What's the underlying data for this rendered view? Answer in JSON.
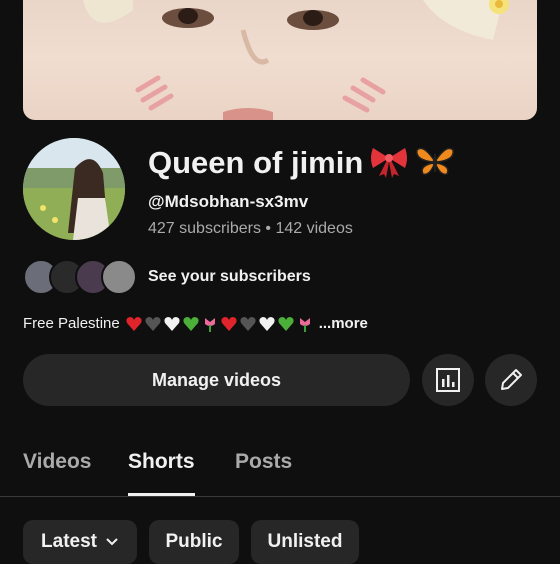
{
  "channel": {
    "name": "Queen of jimin",
    "handle": "@Mdsobhan-sx3mv",
    "subscribers": "427 subscribers",
    "separator": " • ",
    "videos": "142 videos"
  },
  "subscribers_link": {
    "label": "See your subscribers"
  },
  "description": {
    "text": "Free Palestine",
    "more": "...more"
  },
  "actions": {
    "manage_videos": "Manage videos",
    "analytics_icon": "analytics-icon",
    "edit_icon": "pencil-icon"
  },
  "tabs": [
    {
      "label": "Videos",
      "active": false
    },
    {
      "label": "Shorts",
      "active": true
    },
    {
      "label": "Posts",
      "active": false
    }
  ],
  "filters": [
    {
      "label": "Latest",
      "has_dropdown": true
    },
    {
      "label": "Public"
    },
    {
      "label": "Unlisted"
    }
  ],
  "colors": {
    "background": "#0f0f0f",
    "button": "#272727",
    "text": "#f1f1f1",
    "secondary_text": "#aaaaaa"
  }
}
